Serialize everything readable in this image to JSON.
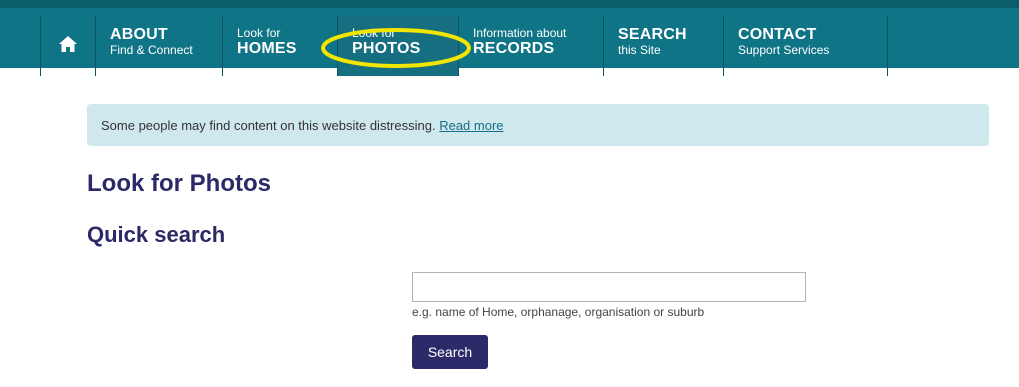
{
  "nav": {
    "home_icon": "home-icon",
    "items": [
      {
        "small": "",
        "big": "ABOUT",
        "sub": "Find & Connect"
      },
      {
        "small": "Look for",
        "big": "HOMES"
      },
      {
        "small": "Look for",
        "big": "PHOTOS"
      },
      {
        "small": "Information about",
        "big": "RECORDS"
      },
      {
        "big": "SEARCH",
        "sub": "this Site"
      },
      {
        "big": "CONTACT",
        "sub": "Support Services"
      }
    ]
  },
  "notice": {
    "text": "Some people may find content on this website distressing.",
    "link": "Read more"
  },
  "page": {
    "title": "Look for Photos",
    "section_title": "Quick search"
  },
  "search": {
    "value": "",
    "hint": "e.g. name of Home, orphanage, organisation or suburb",
    "button": "Search"
  },
  "colors": {
    "nav_bg": "#107487",
    "heading": "#2b2a66",
    "notice_bg": "#cfe8ee",
    "highlight": "#f2e600"
  }
}
